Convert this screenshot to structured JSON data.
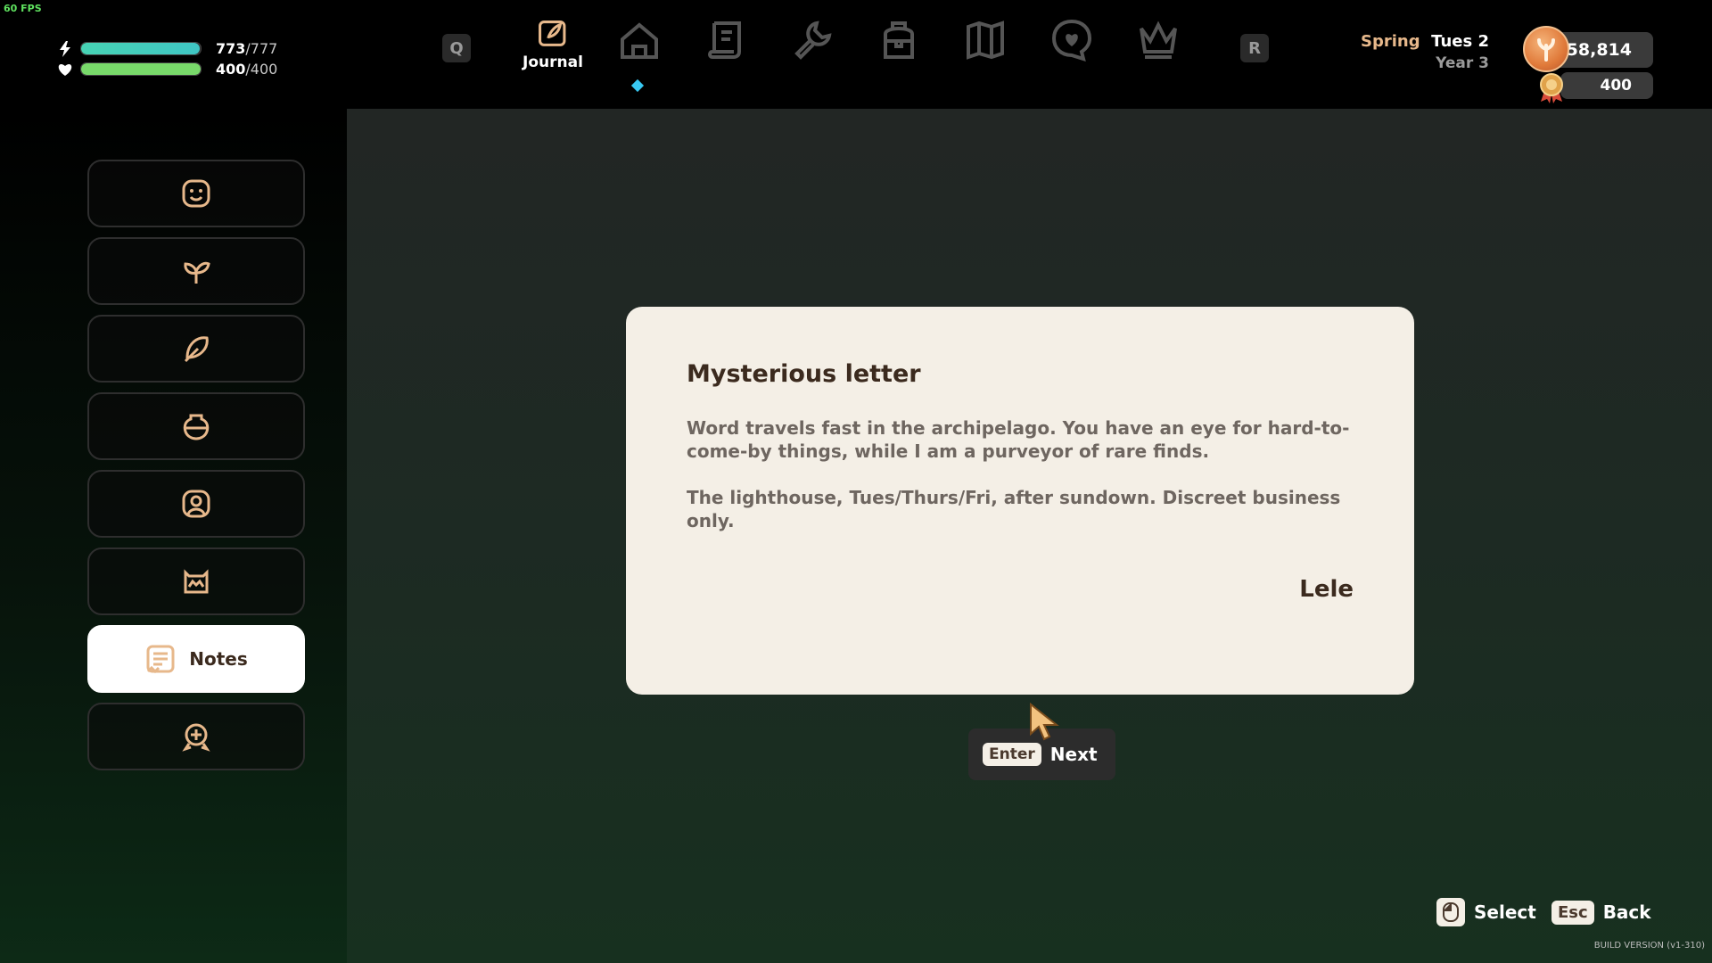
{
  "fps": "60 FPS",
  "stats": {
    "energy": {
      "current": "773",
      "max": "/777",
      "fraction": 0.995,
      "color": "#3fc6c4"
    },
    "health": {
      "current": "400",
      "max": "/400",
      "fraction": 1.0,
      "color": "#78d96a"
    }
  },
  "nav": {
    "prev_key": "Q",
    "next_key": "R",
    "active_label": "Journal",
    "items": [
      "journal-icon",
      "house-icon",
      "scroll-icon",
      "wrench-icon",
      "backpack-icon",
      "map-icon",
      "heart-chat-icon",
      "crown-icon"
    ]
  },
  "date": {
    "season": "Spring",
    "day": "Tues 2",
    "year": "Year 3"
  },
  "currency": {
    "coins": "58,814",
    "tokens": "400"
  },
  "sidebar": {
    "items": [
      {
        "icon": "smiley-icon"
      },
      {
        "icon": "sprout-icon"
      },
      {
        "icon": "feather-icon"
      },
      {
        "icon": "pot-icon"
      },
      {
        "icon": "portrait-icon"
      },
      {
        "icon": "creature-icon"
      },
      {
        "icon": "notes-icon",
        "label": "Notes",
        "active": true
      },
      {
        "icon": "achievement-icon"
      }
    ]
  },
  "letter": {
    "title": "Mysterious letter",
    "paragraph1": "Word travels fast in the archipelago. You have an eye for hard-to-come-by things, while I am a purveyor of rare finds.",
    "paragraph2": "The lighthouse, Tues/Thurs/Fri, after sundown. Discreet business only.",
    "signature": "Lele"
  },
  "prompts": {
    "next": {
      "key": "Enter",
      "label": "Next"
    },
    "select": {
      "label": "Select"
    },
    "back": {
      "key": "Esc",
      "label": "Back"
    }
  },
  "build_version": "BUILD VERSION  (v1-310)",
  "colors": {
    "accent": "#e7b88b",
    "diamond": "#38c8f2",
    "card": "#f4efe6"
  }
}
